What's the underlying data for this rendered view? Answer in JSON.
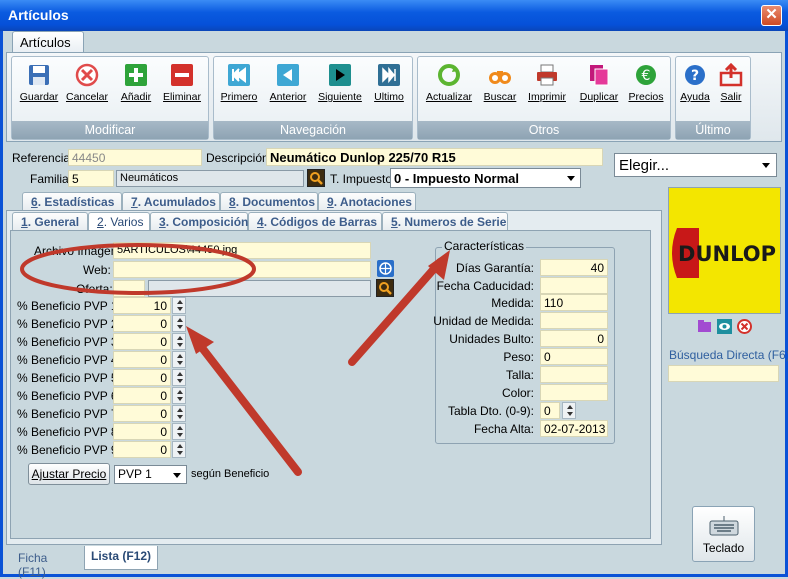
{
  "window": {
    "title": "Artículos",
    "close": "✕"
  },
  "ribbon": {
    "tab": "Artículos",
    "groups": [
      {
        "label": "Modificar"
      },
      {
        "label": "Navegación"
      },
      {
        "label": "Otros"
      },
      {
        "label": "Último"
      }
    ],
    "buttons": {
      "guardar": "Guardar",
      "cancelar": "Cancelar",
      "anadir": "Añadir",
      "eliminar": "Eliminar",
      "primero": "Primero",
      "anterior": "Anterior",
      "siguiente": "Siguiente",
      "ultimo": "Ultimo",
      "actualizar": "Actualizar",
      "buscar": "Buscar",
      "imprimir": "Imprimir",
      "duplicar": "Duplicar",
      "precios": "Precios",
      "ayuda": "Ayuda",
      "salir": "Salir"
    }
  },
  "header": {
    "referencia_label": "Referencia:",
    "referencia": "44450",
    "descripcion_label": "Descripción:",
    "descripcion": "Neumático Dunlop 225/70 R15",
    "elegir": "Elegir...",
    "familia_label": "Familia:",
    "familia_code": "5",
    "familia_name": "Neumáticos",
    "impuesto_label": "T. Impuesto:",
    "impuesto": "0 - Impuesto Normal"
  },
  "tabs_top": [
    {
      "key": "6",
      "label": ". Estadísticas"
    },
    {
      "key": "7",
      "label": ". Acumulados"
    },
    {
      "key": "8",
      "label": ". Documentos"
    },
    {
      "key": "9",
      "label": ". Anotaciones"
    }
  ],
  "tabs_bottom": [
    {
      "key": "1",
      "label": ". General"
    },
    {
      "key": "2",
      "label": ". Varios"
    },
    {
      "key": "3",
      "label": ". Composición"
    },
    {
      "key": "4",
      "label": ". Códigos de Barras"
    },
    {
      "key": "5",
      "label": ". Numeros de Serie"
    }
  ],
  "varios": {
    "archivo_label": "Archivo Imagen:",
    "archivo": "5ARTICULOS\\44450.jpg",
    "web_label": "Web:",
    "web": "",
    "oferta_label": "Oferta:",
    "oferta_code": "",
    "oferta_name": "",
    "pvp": [
      {
        "label": "% Beneficio PVP 1:",
        "value": "10"
      },
      {
        "label": "% Beneficio PVP 2:",
        "value": "0"
      },
      {
        "label": "% Beneficio PVP 3:",
        "value": "0"
      },
      {
        "label": "% Beneficio PVP 4:",
        "value": "0"
      },
      {
        "label": "% Beneficio PVP 5:",
        "value": "0"
      },
      {
        "label": "% Beneficio PVP 6:",
        "value": "0"
      },
      {
        "label": "% Beneficio PVP 7:",
        "value": "0"
      },
      {
        "label": "% Beneficio PVP 8:",
        "value": "0"
      },
      {
        "label": "% Beneficio PVP 9:",
        "value": "0"
      }
    ],
    "ajustar_label": "Ajustar Precio",
    "ajustar_select": "PVP 1",
    "segun": "según Beneficio"
  },
  "caracteristicas": {
    "title": "Características",
    "rows": [
      {
        "label": "Días Garantía:",
        "value": "40"
      },
      {
        "label": "Fecha Caducidad:",
        "value": ""
      },
      {
        "label": "Medida:",
        "value": "110"
      },
      {
        "label": "Unidad de Medida:",
        "value": ""
      },
      {
        "label": "Unidades Bulto:",
        "value": "0"
      },
      {
        "label": "Peso:",
        "value": "0"
      },
      {
        "label": "Talla:",
        "value": ""
      },
      {
        "label": "Color:",
        "value": ""
      },
      {
        "label": "Tabla Dto. (0-9):",
        "value": "0"
      },
      {
        "label": "Fecha Alta:",
        "value": "02-07-2013"
      }
    ]
  },
  "side": {
    "logo_text": "DUNLOP",
    "busqueda_label": "Búsqueda Directa (F6)",
    "busqueda": "",
    "teclado": "Teclado"
  },
  "bottom_tabs": {
    "ficha": "Ficha (F11)",
    "lista": "Lista (F12)"
  },
  "colors": {
    "accent": "#0a5be0",
    "field_bg": "#fffbd8",
    "panel": "#c9d8de",
    "annotation": "#c0392b"
  }
}
